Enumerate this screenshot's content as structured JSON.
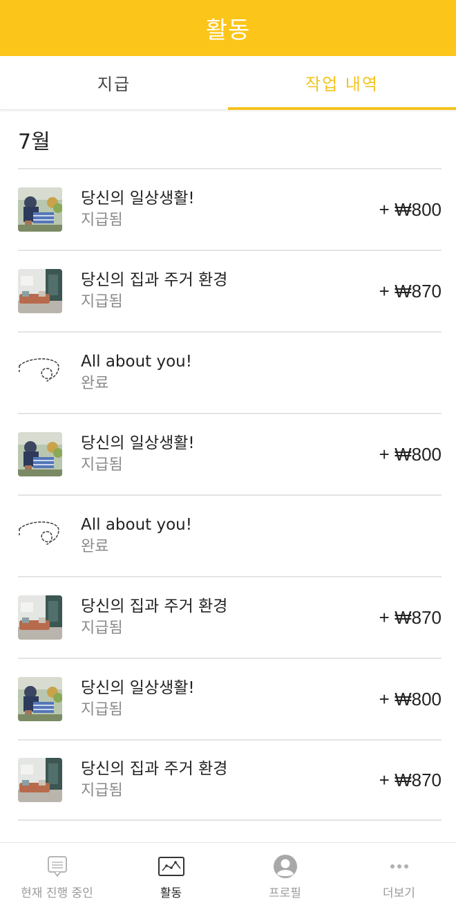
{
  "header": {
    "title": "활동"
  },
  "tabs": [
    {
      "label": "지급",
      "active": false
    },
    {
      "label": "작업 내역",
      "active": true
    }
  ],
  "month": "7월",
  "rows": [
    {
      "title": "당신의 일상생활!",
      "status": "지급됨",
      "amount": "+ ₩800",
      "thumb": "shopping-photo"
    },
    {
      "title": "당신의 집과 주거 환경",
      "status": "지급됨",
      "amount": "+ ₩870",
      "thumb": "living-room-photo"
    },
    {
      "title": "All about you!",
      "status": "완료",
      "amount": "",
      "thumb": "dashed-path-icon"
    },
    {
      "title": "당신의 일상생활!",
      "status": "지급됨",
      "amount": "+ ₩800",
      "thumb": "shopping-photo"
    },
    {
      "title": "All about you!",
      "status": "완료",
      "amount": "",
      "thumb": "dashed-path-icon"
    },
    {
      "title": "당신의 집과 주거 환경",
      "status": "지급됨",
      "amount": "+ ₩870",
      "thumb": "living-room-photo"
    },
    {
      "title": "당신의 일상생활!",
      "status": "지급됨",
      "amount": "+ ₩800",
      "thumb": "shopping-photo"
    },
    {
      "title": "당신의 집과 주거 환경",
      "status": "지급됨",
      "amount": "+ ₩870",
      "thumb": "living-room-photo"
    }
  ],
  "bottom_nav": [
    {
      "label": "현재 진행 중인",
      "icon": "message-icon",
      "active": false
    },
    {
      "label": "활동",
      "icon": "activity-icon",
      "active": true
    },
    {
      "label": "프로필",
      "icon": "profile-icon",
      "active": false
    },
    {
      "label": "더보기",
      "icon": "more-icon",
      "active": false
    }
  ],
  "colors": {
    "accent": "#fcc51a",
    "tab_active": "#f4c21c",
    "muted": "#8a8a8a"
  }
}
